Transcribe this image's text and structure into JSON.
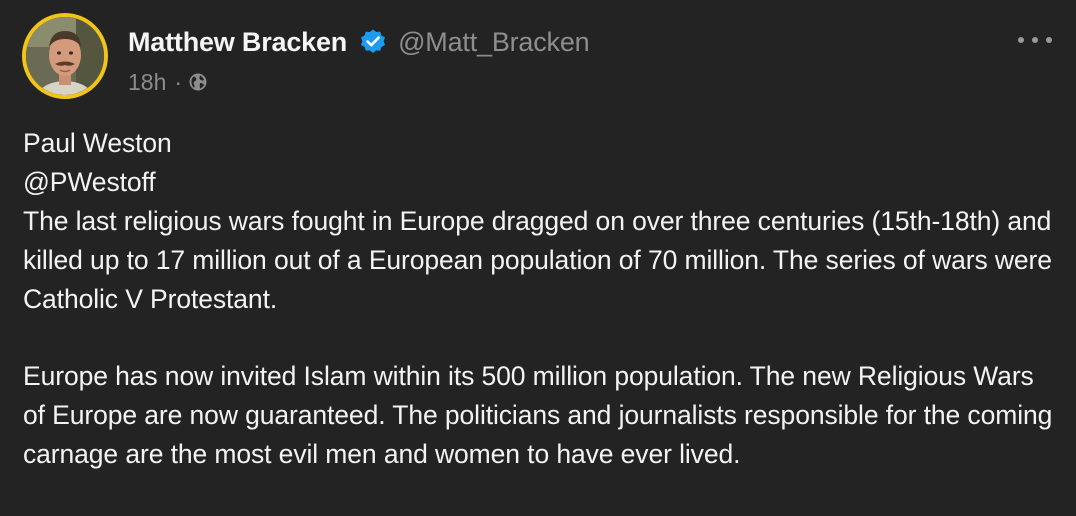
{
  "post": {
    "author": {
      "display_name": "Matthew Bracken",
      "handle": "@Matt_Bracken",
      "verified": true,
      "verified_icon": "verified-badge-icon",
      "avatar_border_color": "#f0c419",
      "badge_color": "#1d9bf0"
    },
    "timestamp": "18h",
    "separator": "·",
    "visibility_icon": "globe-icon",
    "menu_icon": "more-options-icon",
    "body": {
      "quoted_name": "Paul Weston",
      "quoted_handle": "@PWestoff",
      "paragraph_1": "The last religious wars fought in Europe dragged on over three centuries (15th-18th) and killed up to 17 million out of a European population of 70 million. The series of wars were Catholic V Protestant.",
      "paragraph_2": "Europe has now invited Islam within its 500 million population. The new Religious Wars of Europe are now guaranteed. The politicians and journalists responsible for the coming carnage are the most evil men and women to have ever lived."
    }
  },
  "colors": {
    "background": "#232323",
    "text": "#f3f3f3",
    "muted": "#8e8e8e"
  }
}
